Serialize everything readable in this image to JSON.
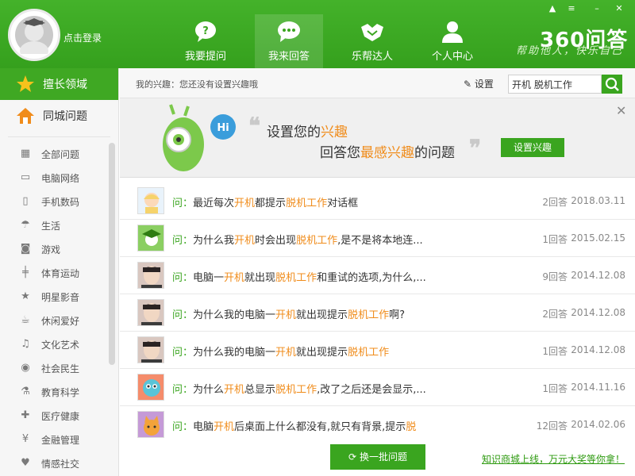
{
  "header": {
    "login_label": "点击登录",
    "nav": [
      {
        "label": "我要提问",
        "icon": "question-bubble-icon",
        "active": false
      },
      {
        "label": "我来回答",
        "icon": "chat-bubble-icon",
        "active": true
      },
      {
        "label": "乐帮达人",
        "icon": "handshake-icon",
        "active": false
      },
      {
        "label": "个人中心",
        "icon": "person-icon",
        "active": false
      }
    ],
    "logo_text": "360问答",
    "slogan": "帮助他人，快乐自己"
  },
  "sidebar": {
    "main": [
      {
        "label": "擅长领域",
        "icon": "star-icon"
      },
      {
        "label": "同城问题",
        "icon": "house-icon"
      }
    ],
    "items": [
      {
        "label": "全部问题",
        "icon": "grid-icon"
      },
      {
        "label": "电脑网络",
        "icon": "monitor-icon"
      },
      {
        "label": "手机数码",
        "icon": "phone-icon"
      },
      {
        "label": "生活",
        "icon": "umbrella-icon"
      },
      {
        "label": "游戏",
        "icon": "gamepad-icon"
      },
      {
        "label": "体育运动",
        "icon": "dumbbell-icon"
      },
      {
        "label": "明星影音",
        "icon": "star-outline-icon"
      },
      {
        "label": "休闲爱好",
        "icon": "cup-icon"
      },
      {
        "label": "文化艺术",
        "icon": "music-icon"
      },
      {
        "label": "社会民生",
        "icon": "globe-icon"
      },
      {
        "label": "教育科学",
        "icon": "flask-icon"
      },
      {
        "label": "医疗健康",
        "icon": "medical-icon"
      },
      {
        "label": "金融管理",
        "icon": "yen-icon"
      },
      {
        "label": "情感社交",
        "icon": "heart-icon"
      }
    ]
  },
  "topbar": {
    "interest_label": "我的兴趣：您还没有设置兴趣哦",
    "settings_label": "设置",
    "search_value": "开机 脱机工作"
  },
  "banner": {
    "line1_pre": "设置您的",
    "line1_hl": "兴趣",
    "line2_pre": "回答您",
    "line2_hl": "最感兴趣",
    "line2_post": "的问题",
    "button_label": "设置兴趣",
    "mascot_bubble": "Hi"
  },
  "questions": [
    {
      "prefix": "问：",
      "parts": [
        [
          "最近每次",
          ""
        ],
        [
          "开机",
          "kw"
        ],
        [
          "都提示",
          ""
        ],
        [
          "脱机工作",
          "kw"
        ],
        [
          "对话框",
          ""
        ]
      ],
      "answers": "2回答",
      "date": "2018.03.11",
      "avatar": "baby"
    },
    {
      "prefix": "问：",
      "parts": [
        [
          "为什么我",
          ""
        ],
        [
          "开机",
          "kw"
        ],
        [
          "时会出现",
          ""
        ],
        [
          "脱机工作",
          "kw"
        ],
        [
          ",是不是将本地连...",
          ""
        ]
      ],
      "answers": "1回答",
      "date": "2015.02.15",
      "avatar": "graduate"
    },
    {
      "prefix": "问：",
      "parts": [
        [
          "电脑一",
          ""
        ],
        [
          "开机",
          "kw"
        ],
        [
          "就出现",
          ""
        ],
        [
          "脱机工作",
          "kw"
        ],
        [
          "和重试的选项,为什么,...",
          ""
        ]
      ],
      "answers": "9回答",
      "date": "2014.12.08",
      "avatar": "photo"
    },
    {
      "prefix": "问：",
      "parts": [
        [
          "为什么我的电脑一",
          ""
        ],
        [
          "开机",
          "kw"
        ],
        [
          "就出现提示",
          ""
        ],
        [
          "脱机工作",
          "kw"
        ],
        [
          "啊?",
          ""
        ]
      ],
      "answers": "2回答",
      "date": "2014.12.08",
      "avatar": "photo"
    },
    {
      "prefix": "问：",
      "parts": [
        [
          "为什么我的电脑一",
          ""
        ],
        [
          "开机",
          "kw"
        ],
        [
          "就出现提示",
          ""
        ],
        [
          "脱机工作",
          "kw"
        ]
      ],
      "answers": "1回答",
      "date": "2014.12.08",
      "avatar": "photo"
    },
    {
      "prefix": "问：",
      "parts": [
        [
          "为什么",
          ""
        ],
        [
          "开机",
          "kw"
        ],
        [
          "总显示",
          ""
        ],
        [
          "脱机工作",
          "kw"
        ],
        [
          ",改了之后还是会显示,...",
          ""
        ]
      ],
      "answers": "1回答",
      "date": "2014.11.16",
      "avatar": "cartoon"
    },
    {
      "prefix": "问：",
      "parts": [
        [
          "电脑",
          ""
        ],
        [
          "开机",
          "kw"
        ],
        [
          "后桌面上什么都没有,就只有背景,提示",
          ""
        ],
        [
          "脱",
          "kw"
        ]
      ],
      "answers": "12回答",
      "date": "2014.02.06",
      "avatar": "cat"
    }
  ],
  "bottom": {
    "change_label": "换一批问题",
    "promo_label": "知识商城上线，万元大奖等你拿！"
  },
  "colors": {
    "brand": "#3aa51f",
    "highlight": "#f08c1b"
  }
}
